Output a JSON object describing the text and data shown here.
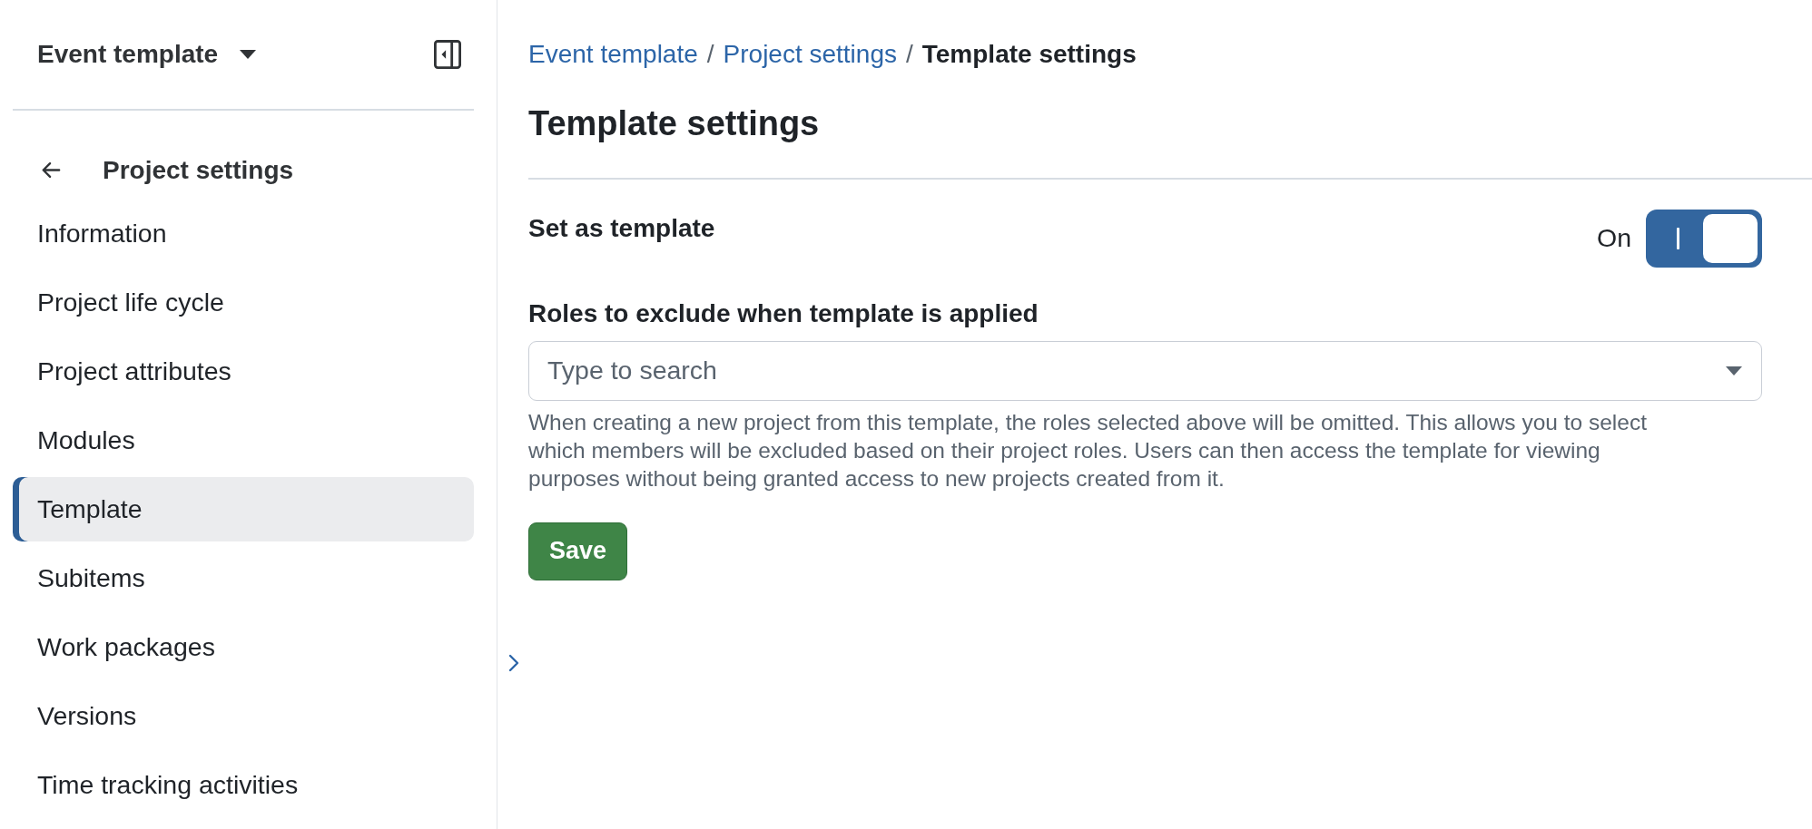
{
  "sidebar": {
    "project_name": "Event template",
    "back_label": "Project settings",
    "items": [
      {
        "label": "Information",
        "selected": false
      },
      {
        "label": "Project life cycle",
        "selected": false
      },
      {
        "label": "Project attributes",
        "selected": false
      },
      {
        "label": "Modules",
        "selected": false
      },
      {
        "label": "Template",
        "selected": true
      },
      {
        "label": "Subitems",
        "selected": false
      },
      {
        "label": "Work packages",
        "selected": false
      },
      {
        "label": "Versions",
        "selected": false
      },
      {
        "label": "Time tracking activities",
        "selected": false
      }
    ]
  },
  "breadcrumb": [
    {
      "kind": "link",
      "label": "Event template"
    },
    {
      "kind": "separator",
      "label": "/"
    },
    {
      "kind": "link",
      "label": "Project settings"
    },
    {
      "kind": "separator",
      "label": "/"
    },
    {
      "kind": "current",
      "label": "Template settings"
    }
  ],
  "page_title": "Template settings",
  "set_as_template": {
    "label": "Set as template",
    "state_label": "On",
    "on": true
  },
  "roles_field": {
    "label": "Roles to exclude when template is applied",
    "placeholder": "Type to search",
    "help": "When creating a new project from this template, the roles selected above will be omitted. This allows you to select which members will be excluded based on their project roles. Users can then access the template for viewing purposes without being granted access to new projects created from it."
  },
  "save_button": "Save"
}
